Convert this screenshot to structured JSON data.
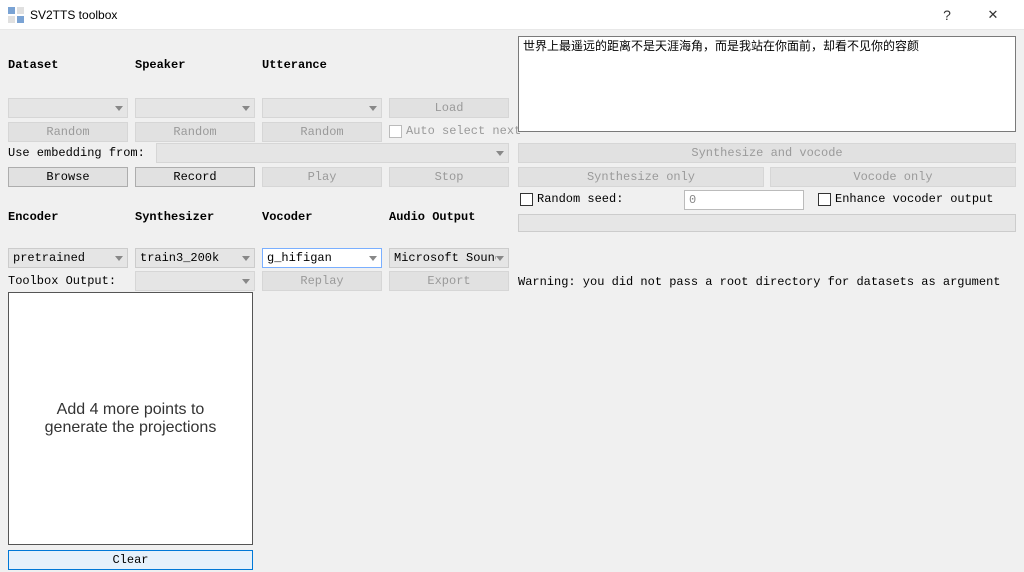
{
  "window": {
    "title": "SV2TTS toolbox",
    "help_glyph": "?",
    "close_glyph": "✕"
  },
  "labels": {
    "dataset": "Dataset",
    "speaker": "Speaker",
    "utterance": "Utterance",
    "use_embedding_from": "Use embedding from:",
    "encoder": "Encoder",
    "synthesizer": "Synthesizer",
    "vocoder": "Vocoder",
    "audio_output": "Audio Output",
    "toolbox_output": "Toolbox Output:"
  },
  "buttons": {
    "load": "Load",
    "random_dataset": "Random",
    "random_speaker": "Random",
    "random_utterance": "Random",
    "browse": "Browse",
    "record": "Record",
    "play": "Play",
    "stop": "Stop",
    "replay": "Replay",
    "export": "Export",
    "synthesize_vocode": "Synthesize and vocode",
    "synthesize_only": "Synthesize only",
    "vocode_only": "Vocode only",
    "clear": "Clear"
  },
  "checkboxes": {
    "auto_select_next": "Auto select next",
    "random_seed": "Random seed:",
    "enhance_vocoder": "Enhance vocoder output"
  },
  "combos": {
    "dataset": "",
    "speaker": "",
    "utterance": "",
    "embedding_from": "",
    "encoder": "pretrained",
    "synthesizer": "train3_200k",
    "vocoder": "g_hifigan",
    "audio_output": "Microsoft Sound Mapp",
    "toolbox_output": ""
  },
  "inputs": {
    "text_to_synthesize": "世界上最遥远的距离不是天涯海角，而是我站在你面前，却看不见你的容颜",
    "random_seed_value": "0"
  },
  "viz": {
    "message": "Add 4 more points to\ngenerate the projections"
  },
  "status": {
    "warning": "Warning: you did not pass a root directory for datasets as argument"
  }
}
